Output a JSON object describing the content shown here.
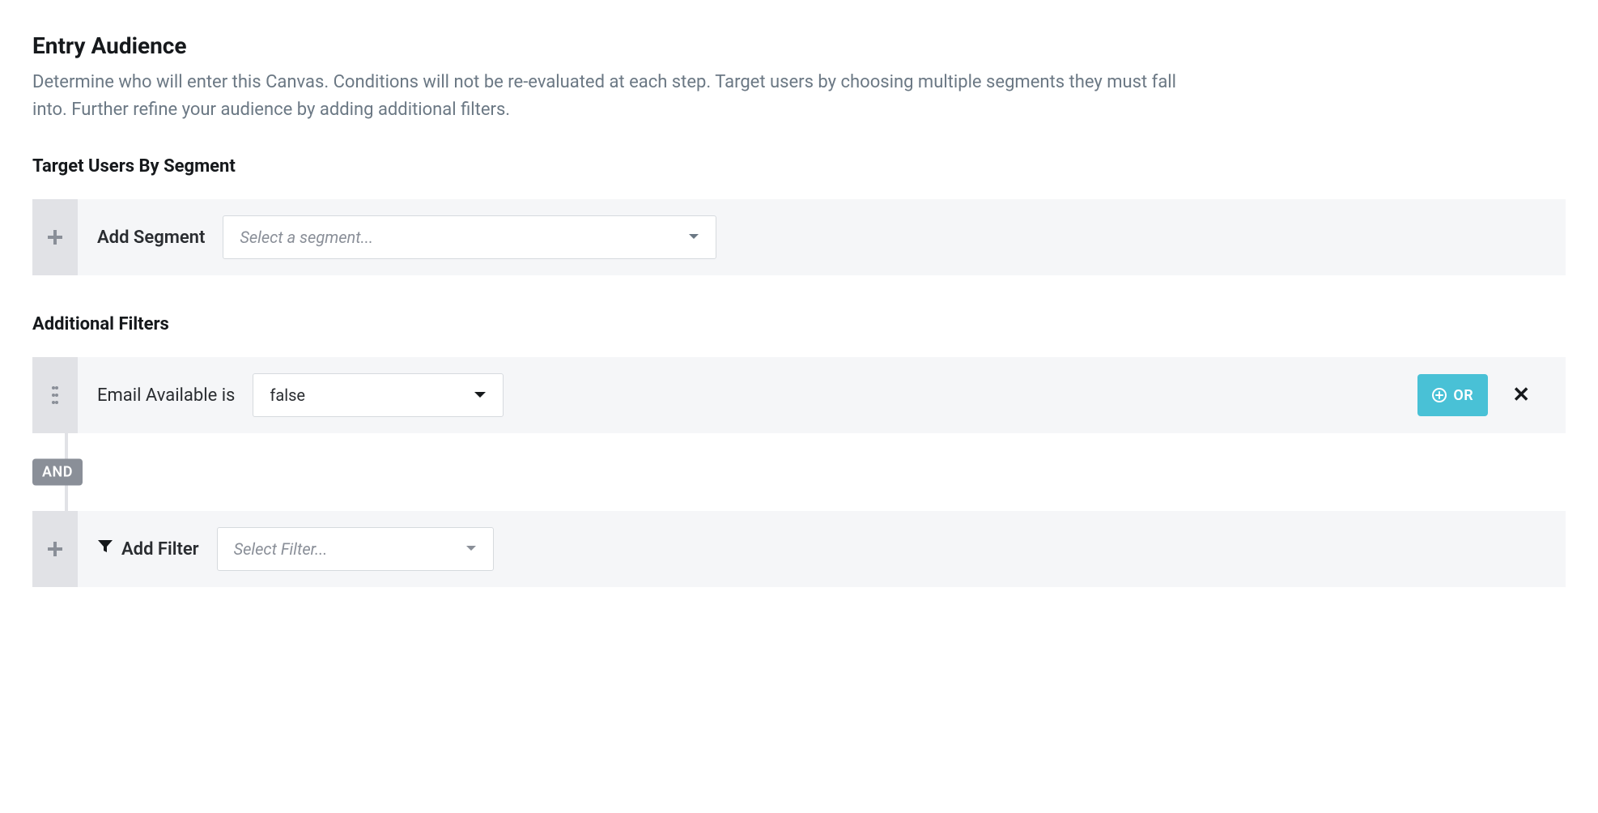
{
  "header": {
    "title": "Entry Audience",
    "description": "Determine who will enter this Canvas. Conditions will not be re-evaluated at each step. Target users by choosing multiple segments they must fall into. Further refine your audience by adding additional filters."
  },
  "segments": {
    "section_label": "Target Users By Segment",
    "add_label": "Add Segment",
    "select_placeholder": "Select a segment..."
  },
  "filters": {
    "section_label": "Additional Filters",
    "connector_label": "AND",
    "rows": [
      {
        "attribute_label": "Email Available is",
        "value": "false",
        "or_label": "OR"
      }
    ],
    "add_label": "Add Filter",
    "add_select_placeholder": "Select Filter..."
  }
}
